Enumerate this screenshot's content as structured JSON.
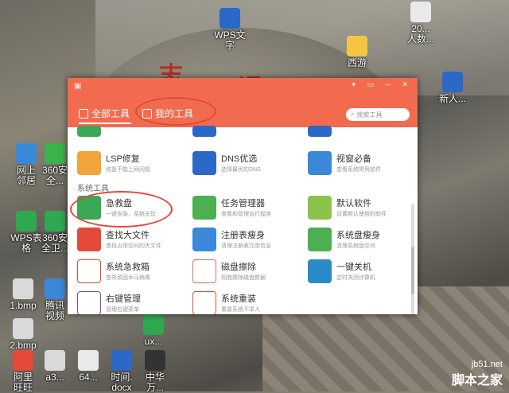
{
  "desktop": {
    "icons": [
      {
        "label": "20...\n人数...",
        "color": "#e9e9e9"
      },
      {
        "label": "西游",
        "color": "#f5c542"
      },
      {
        "label": "新人...",
        "color": "#2b68c8"
      },
      {
        "label": "WPS文\n字",
        "color": "#2b68c8"
      },
      {
        "label": "网上\n邻居",
        "color": "#3a88d8"
      },
      {
        "label": "360安\n全...",
        "color": "#3bb34a"
      },
      {
        "label": "WPS表\n格",
        "color": "#2fa84f"
      },
      {
        "label": "360安\n全卫...",
        "color": "#2fa84f"
      },
      {
        "label": "1.bmp",
        "color": "#d9d9d9"
      },
      {
        "label": "腾讯\n视频",
        "color": "#3a88d8"
      },
      {
        "label": "2.bmp",
        "color": "#d9d9d9"
      },
      {
        "label": "ux...",
        "color": "#2fa84f"
      },
      {
        "label": "阿里\n旺旺",
        "color": "#e34a3a"
      },
      {
        "label": "a3...",
        "color": "#d9d9d9"
      },
      {
        "label": "64...",
        "color": "#e9e9e9"
      },
      {
        "label": "时间.\ndocx",
        "color": "#2b68c8"
      },
      {
        "label": "中华\n万...",
        "color": "#333333"
      }
    ]
  },
  "window": {
    "tabs": [
      {
        "label": "全部工具"
      },
      {
        "label": "我的工具"
      }
    ],
    "search_placeholder": "搜索工具",
    "section_label": "系统工具",
    "tools": [
      {
        "name": "LSP修复",
        "desc": "修复不能上网问题",
        "color": "#f2a33a"
      },
      {
        "name": "DNS优选",
        "desc": "选择最优的DNS",
        "color": "#2b68c8"
      },
      {
        "name": "视窗必备",
        "desc": "查看系统常用软件",
        "color": "#3a88d8"
      },
      {
        "name": "急救盘",
        "desc": "一键安装，系统无忧",
        "color": "#3aa857"
      },
      {
        "name": "任务管理器",
        "desc": "查看和管理运行程序",
        "color": "#4caf50"
      },
      {
        "name": "默认软件",
        "desc": "设置默认使用的软件",
        "color": "#8bc34a"
      },
      {
        "name": "查找大文件",
        "desc": "查找占用空间的大文件",
        "color": "#e34a3a"
      },
      {
        "name": "注册表瘦身",
        "desc": "清理注册表冗余信息",
        "color": "#3a88d8"
      },
      {
        "name": "系统盘瘦身",
        "desc": "清理系统盘空间",
        "color": "#4caf50"
      },
      {
        "name": "系统急救箱",
        "desc": "查杀顽固木马病毒",
        "color": "#e34a3a"
      },
      {
        "name": "磁盘擦除",
        "desc": "彻底擦除磁盘数据",
        "color": "#e86a5a"
      },
      {
        "name": "一键关机",
        "desc": "定时关闭计算机",
        "color": "#2b8ac8"
      },
      {
        "name": "右键管理",
        "desc": "管理右键菜单",
        "color": "#7b4aa8"
      },
      {
        "name": "系统重装",
        "desc": "重装系统不求人",
        "color": "#e34a3a"
      }
    ]
  },
  "watermark": {
    "site": "jb51.net",
    "brand": "脚本之家"
  }
}
